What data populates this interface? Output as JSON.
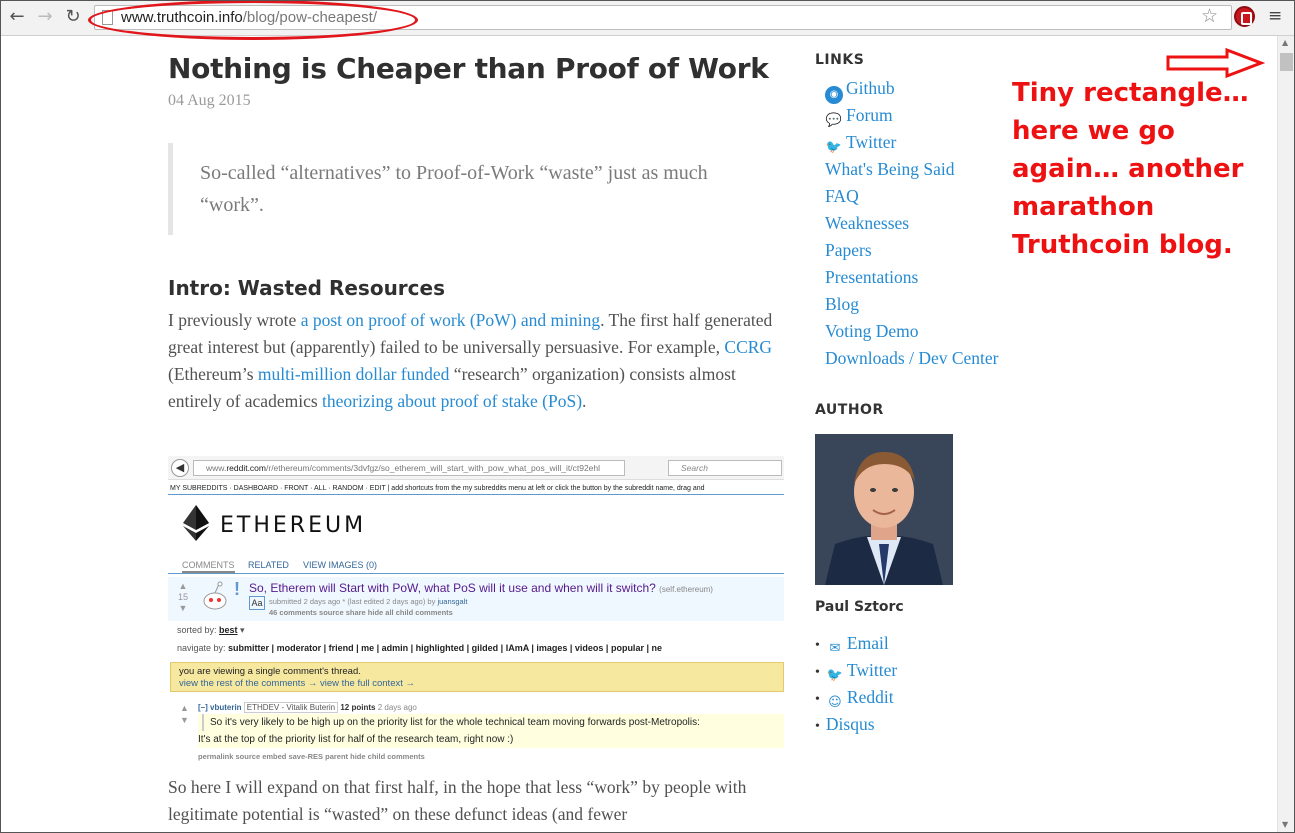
{
  "browser": {
    "url_host": "www.truthcoin.info",
    "url_path": "/blog/pow-cheapest/",
    "back_icon": "back-arrow-icon",
    "forward_icon": "forward-arrow-icon",
    "reload_icon": "reload-icon",
    "annotation_color": "#e0161c"
  },
  "post": {
    "title": "Nothing is Cheaper than Proof of Work",
    "date": "04 Aug 2015",
    "quote": "So-called “alternatives” to Proof-of-Work “waste” just as much “work”.",
    "section_heading": "Intro: Wasted Resources",
    "p1": {
      "t1": "I previously wrote ",
      "l1": "a post on proof of work (PoW) and mining",
      "t2": ". The first half generated great interest but (apparently) failed to be universally persuasive. For example, ",
      "l2": "CCRG",
      "t3": " (Ethereum’s ",
      "l3": "multi-million dollar funded",
      "t4": " “research” organization) consists almost entirely of academics ",
      "l4": "theorizing about proof of stake (PoS)",
      "t5": "."
    },
    "p2": "So here I will expand on that first half, in the hope that less “work” by people with legitimate potential is “wasted” on these defunct ideas (and fewer",
    "link_color": "#268bd2"
  },
  "screenshot": {
    "url_prefix": "www.",
    "url_host": "reddit.com",
    "url_rest": "/r/ethereum/comments/3dvfgz/so_etherem_will_start_with_pow_what_pos_will_it/ct92ehl",
    "search_placeholder": "Search",
    "subreddit_bar": "MY SUBREDDITS · DASHBOARD · FRONT · ALL · RANDOM · EDIT  |  add shortcuts from the my subreddits menu at left or click the button by the subreddit name, drag and",
    "subreddit_name": "ETHEREUM",
    "tabs": [
      "COMMENTS",
      "RELATED",
      "VIEW IMAGES (0)"
    ],
    "score": "15",
    "post_title": "So, Etherem will Start with PoW, what PoS will it use and when will it switch?",
    "post_domain": "(self.ethereum)",
    "post_meta_pre": "submitted 2 days ago * (last edited 2 days ago) by ",
    "post_author": "juansgalt",
    "post_links": "46 comments   source   share   hide all child comments",
    "sorted_label": "sorted by: ",
    "sorted_value": "best",
    "navigate_label": "navigate by: ",
    "navigate_items": "submitter | moderator | friend | me | admin | highlighted | gilded | IAmA | images | videos | popular | ne",
    "notice_line1": "you are viewing a single comment's thread.",
    "notice_line2": "view the rest of the comments → view the full context →",
    "comment_toggle": "[–] ",
    "comment_author": "vbuterin",
    "comment_flair": "ETHDEV - Vitalik Buterin",
    "comment_points": "12 points",
    "comment_time": "2 days ago",
    "comment_quote": "So it's very likely to be high up on the priority list for the whole technical team moving forwards post-Metropolis:",
    "comment_reply": "It's at the top of the priority list for half of the research team, right now :)",
    "comment_links": "permalink   source   embed   save-RES   parent   hide child comments"
  },
  "sidebar": {
    "links_heading": "LINKS",
    "links": [
      {
        "label": "Github",
        "icon": "github-icon"
      },
      {
        "label": "Forum",
        "icon": "comments-icon"
      },
      {
        "label": "Twitter",
        "icon": "twitter-icon"
      },
      {
        "label": "What's Being Said"
      },
      {
        "label": "FAQ"
      },
      {
        "label": "Weaknesses"
      },
      {
        "label": "Papers"
      },
      {
        "label": "Presentations"
      },
      {
        "label": "Blog"
      },
      {
        "label": "Voting Demo"
      },
      {
        "label": "Downloads / Dev Center"
      }
    ],
    "author_heading": "AUTHOR",
    "author_name": "Paul Sztorc",
    "author_links": [
      {
        "label": "Email",
        "icon": "envelope-icon"
      },
      {
        "label": "Twitter",
        "icon": "twitter-icon"
      },
      {
        "label": "Reddit",
        "icon": "reddit-icon"
      },
      {
        "label": "Disqus"
      }
    ]
  },
  "annotation": {
    "text": "Tiny rectangle… here we go again… another marathon Truthcoin blog.",
    "color": "#ee1111"
  }
}
